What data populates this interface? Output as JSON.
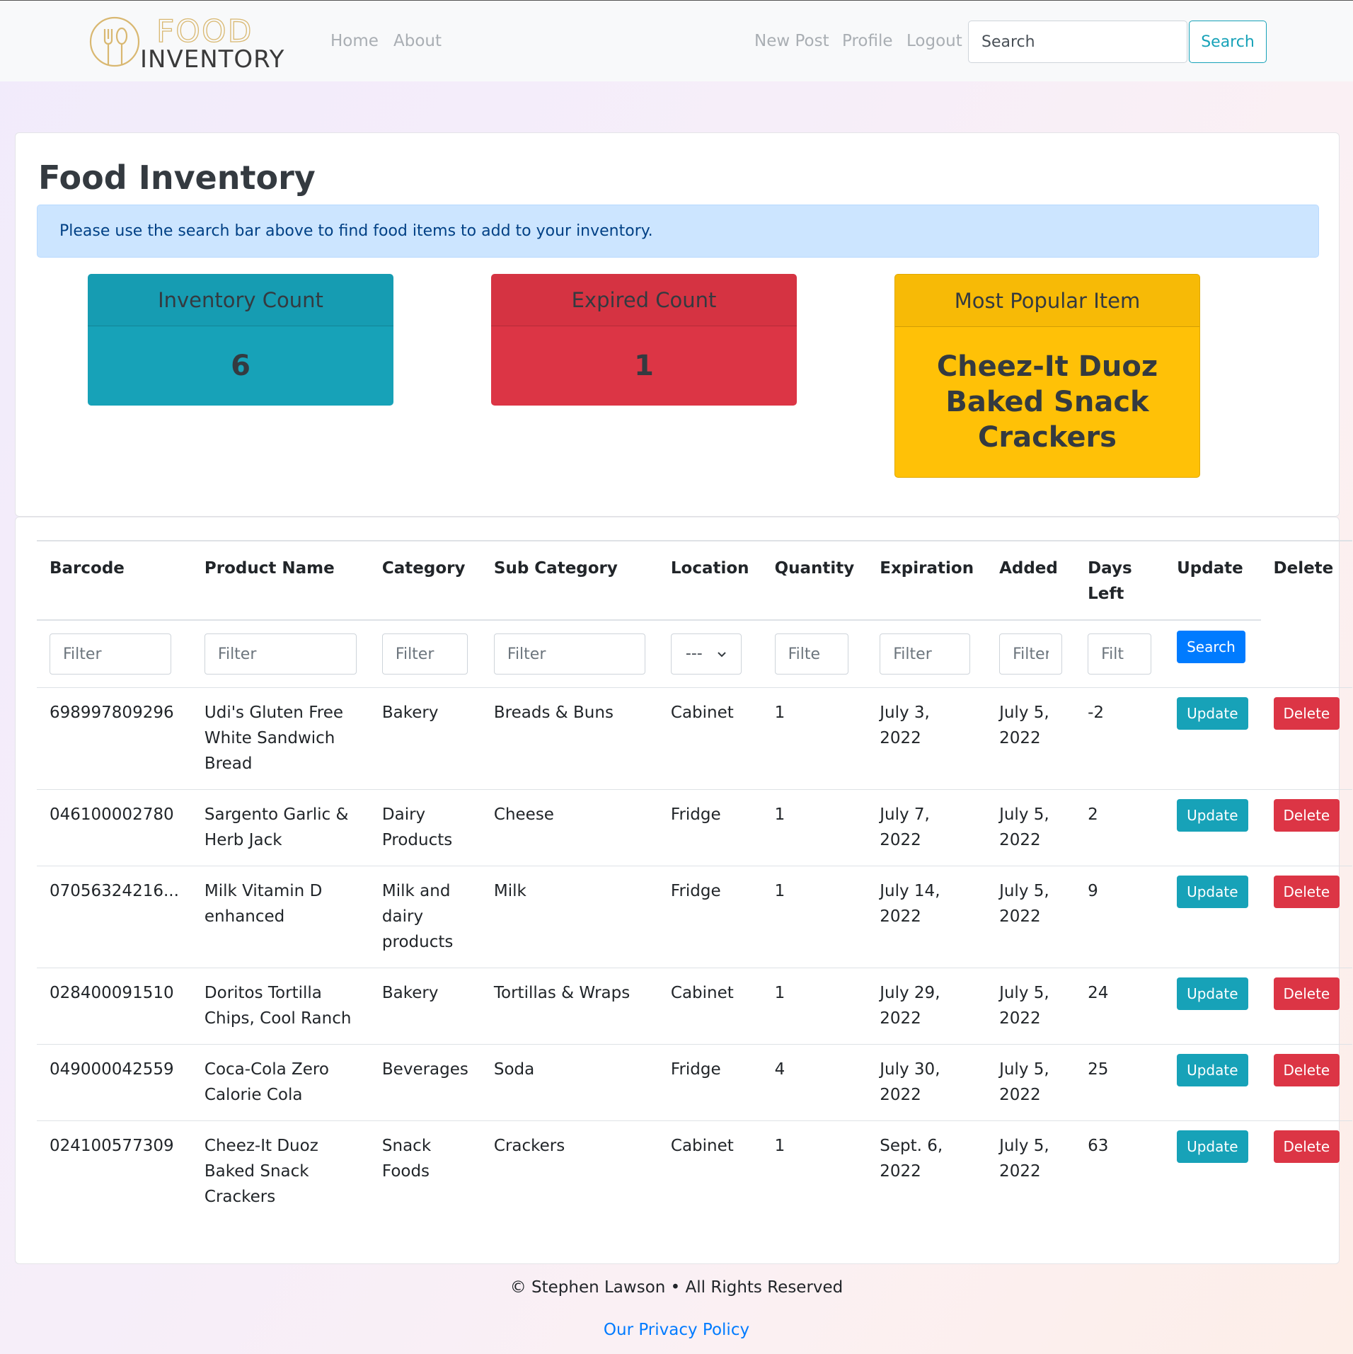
{
  "nav": {
    "logo_top": "FOOD",
    "logo_bottom": "INVENTORY",
    "home": "Home",
    "about": "About",
    "new_post": "New Post",
    "profile": "Profile",
    "logout": "Logout",
    "search_placeholder": "Search",
    "search_button": "Search"
  },
  "page": {
    "title": "Food Inventory",
    "alert": "Please use the search bar above to find food items to add to your inventory."
  },
  "stats": {
    "inventory_label": "Inventory Count",
    "inventory_value": "6",
    "expired_label": "Expired Count",
    "expired_value": "1",
    "popular_label": "Most Popular Item",
    "popular_value": "Cheez-It Duoz Baked Snack Crackers"
  },
  "colors": {
    "info": "#17a2b8",
    "danger": "#dc3545",
    "warning": "#ffc107",
    "primary": "#007bff"
  },
  "table": {
    "headers": [
      "Barcode",
      "Product Name",
      "Category",
      "Sub Category",
      "Location",
      "Quantity",
      "Expiration",
      "Added",
      "Days Left",
      "Update",
      "Delete"
    ],
    "filter_placeholders": [
      "Filter",
      "Filter",
      "Filter",
      "Filter",
      "---",
      "Filte",
      "Filter",
      "Filter",
      "Filt"
    ],
    "filter_button": "Search",
    "update_label": "Update",
    "delete_label": "Delete",
    "rows": [
      [
        "698997809296",
        "Udi's Gluten Free White Sandwich Bread",
        "Bakery",
        "Breads & Buns",
        "Cabinet",
        "1",
        "July 3, 2022",
        "July 5, 2022",
        "-2"
      ],
      [
        "046100002780",
        "Sargento Garlic & Herb Jack",
        "Dairy Products",
        "Cheese",
        "Fridge",
        "1",
        "July 7, 2022",
        "July 5, 2022",
        "2"
      ],
      [
        "07056324216...",
        "Milk Vitamin D enhanced",
        "Milk and dairy products",
        "Milk",
        "Fridge",
        "1",
        "July 14, 2022",
        "July 5, 2022",
        "9"
      ],
      [
        "028400091510",
        "Doritos Tortilla Chips, Cool Ranch",
        "Bakery",
        "Tortillas & Wraps",
        "Cabinet",
        "1",
        "July 29, 2022",
        "July 5, 2022",
        "24"
      ],
      [
        "049000042559",
        "Coca-Cola Zero Calorie Cola",
        "Beverages",
        "Soda",
        "Fridge",
        "4",
        "July 30, 2022",
        "July 5, 2022",
        "25"
      ],
      [
        "024100577309",
        "Cheez-It Duoz Baked Snack Crackers",
        "Snack Foods",
        "Crackers",
        "Cabinet",
        "1",
        "Sept. 6, 2022",
        "July 5, 2022",
        "63"
      ]
    ]
  },
  "footer": {
    "copyright": "© Stephen Lawson • All Rights Reserved",
    "privacy": "Our Privacy Policy"
  }
}
